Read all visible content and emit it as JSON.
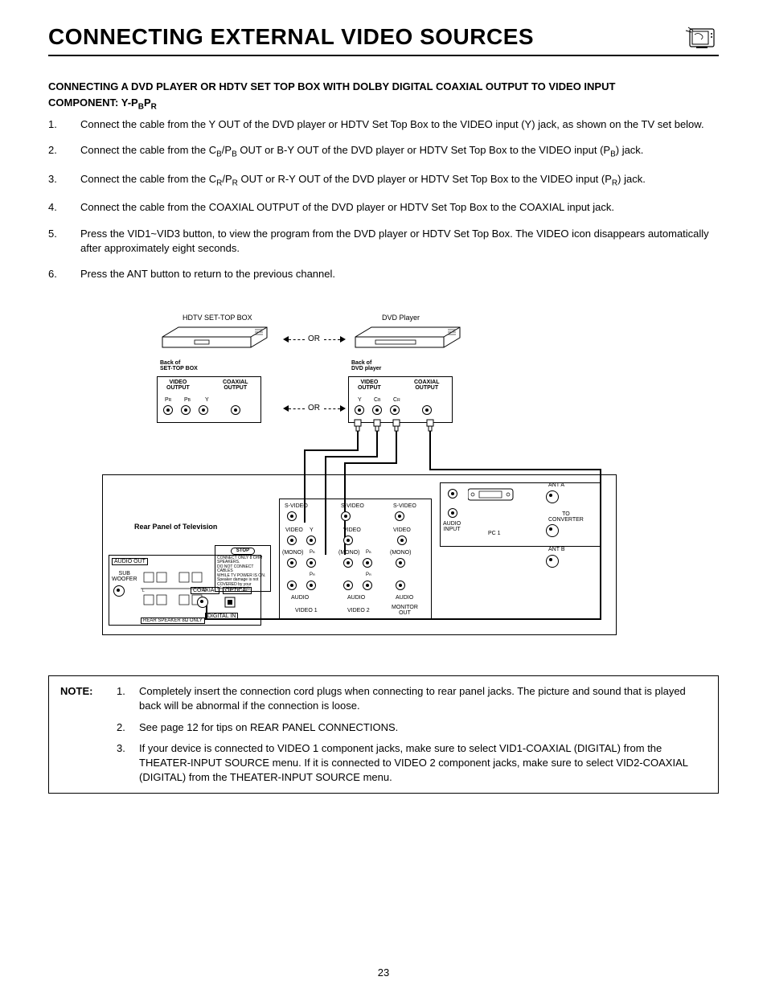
{
  "page": {
    "title": "CONNECTING EXTERNAL VIDEO SOURCES",
    "number": "23"
  },
  "heading": {
    "line1": "CONNECTING A DVD PLAYER OR HDTV SET TOP BOX WITH DOLBY DIGITAL COAXIAL OUTPUT TO VIDEO INPUT",
    "line2_prefix": "COMPONENT:  Y-P",
    "line2_sub1": "B",
    "line2_mid": "P",
    "line2_sub2": "R"
  },
  "steps": [
    "Connect the cable from the Y OUT of the DVD player or HDTV Set Top Box to the VIDEO input (Y) jack, as shown on the TV set below.",
    "Connect the cable from the C_B/P_B OUT or B-Y OUT of the DVD player or HDTV Set Top Box to the VIDEO input (P_B) jack.",
    "Connect the cable from the C_R/P_R OUT or R-Y OUT of the DVD player or HDTV Set Top Box to the VIDEO input (P_R) jack.",
    "Connect the cable from the COAXIAL OUTPUT of the DVD player or HDTV Set Top Box to the COAXIAL input jack.",
    "Press the VID1~VID3 button, to view the program from the DVD player or HDTV Set Top Box.  The VIDEO icon disappears automatically after approximately eight seconds.",
    "Press the ANT button to return to the previous channel."
  ],
  "step2_parts": {
    "p1": "Connect the cable from the C",
    "s1": "B",
    "p2": "/P",
    "s2": "B",
    "p3": " OUT or B-Y OUT of the DVD player or HDTV Set Top Box to the VIDEO input (P",
    "s3": "B",
    "p4": ") jack."
  },
  "step3_parts": {
    "p1": "Connect the cable from the C",
    "s1": "R",
    "p2": "/P",
    "s2": "R",
    "p3": " OUT or R-Y OUT of the DVD player or HDTV Set Top Box to the VIDEO input (P",
    "s3": "R",
    "p4": ") jack."
  },
  "diagram": {
    "hdtv_label": "HDTV SET-TOP BOX",
    "dvd_label": "DVD Player",
    "or": "OR",
    "back_stb": "Back of\nSET-TOP BOX",
    "back_dvd": "Back of\nDVD player",
    "video_output": "VIDEO\nOUTPUT",
    "coax_output": "COAXIAL\nOUTPUT",
    "pr": "PR",
    "pb": "PB",
    "y": "Y",
    "cb": "CB",
    "cr": "CR",
    "rear_panel": "Rear Panel of Television",
    "svideo": "S-VIDEO",
    "video": "VIDEO",
    "mono": "(MONO)",
    "audio": "AUDIO",
    "video1": "VIDEO 1",
    "video2": "VIDEO 2",
    "monitor_out": "MONITOR\nOUT",
    "ant_a": "ANT A",
    "ant_b": "ANT B",
    "to_converter": "TO\nCONVERTER",
    "pc1": "PC 1",
    "audio_input": "AUDIO\nINPUT",
    "audio_out": "AUDIO OUT",
    "sub_woofer": "SUB\nWOOFER",
    "rear_speaker": "REAR SPEAKER 8Ω ONLY",
    "coaxial": "COAXIAL",
    "optical": "OPTICAL",
    "digital_in": "DIGITAL IN",
    "stop": "STOP",
    "stop_text": "CONNECT ONLY 8 OHM SPEAKERS.\nDO NOT CONNECT CABLES\nWHILE TV POWER IS ON.\nSpeaker damage is not\nCOVERED by your television warranty."
  },
  "note": {
    "label": "NOTE:",
    "items": [
      "Completely insert the connection cord plugs when connecting to rear panel jacks.  The picture and sound that is played back will be abnormal if the connection is loose.",
      "See page 12 for tips on REAR PANEL CONNECTIONS.",
      "If your device is connected to VIDEO 1 component jacks, make sure to select VID1-COAXIAL (DIGITAL) from the THEATER-INPUT SOURCE menu.  If it is connected to VIDEO 2 component jacks, make sure to select VID2-COAXIAL (DIGITAL) from the THEATER-INPUT SOURCE menu."
    ]
  }
}
